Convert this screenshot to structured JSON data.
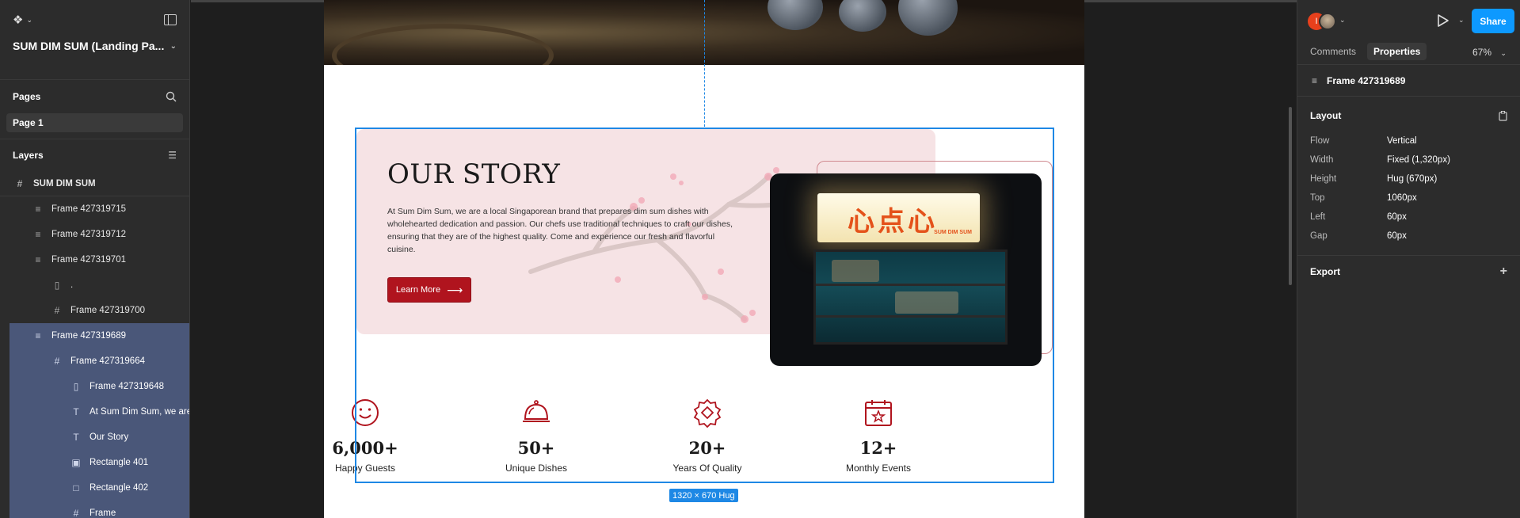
{
  "left_panel": {
    "file_title": "SUM DIM SUM (Landing Pa...",
    "pages_heading": "Pages",
    "current_page": "Page 1",
    "layers_heading": "Layers",
    "layers": [
      {
        "label": "SUM DIM SUM",
        "icon": "frame-icon"
      },
      {
        "label": "Frame 427319715",
        "icon": "auto-layout-icon"
      },
      {
        "label": "Frame 427319712",
        "icon": "auto-layout-icon"
      },
      {
        "label": "Frame 427319701",
        "icon": "auto-layout-icon"
      },
      {
        "label": ".",
        "icon": "component-instance-icon"
      },
      {
        "label": "Frame 427319700",
        "icon": "frame-icon"
      },
      {
        "label": "Frame 427319689",
        "icon": "auto-layout-icon"
      },
      {
        "label": "Frame 427319664",
        "icon": "frame-icon"
      },
      {
        "label": "Frame 427319648",
        "icon": "component-instance-icon"
      },
      {
        "label": "At Sum Dim Sum, we are",
        "icon": "text-icon"
      },
      {
        "label": "Our Story",
        "icon": "text-icon"
      },
      {
        "label": "Rectangle 401",
        "icon": "image-icon"
      },
      {
        "label": "Rectangle 402",
        "icon": "rectangle-icon"
      },
      {
        "label": "Frame",
        "icon": "frame-icon"
      }
    ]
  },
  "canvas": {
    "story_title": "OUR STORY",
    "story_body": "At Sum Dim Sum, we are a local Singaporean brand that prepares dim sum dishes with wholehearted dedication and passion. Our chefs use traditional techniques to craft our dishes, ensuring that they are of the highest quality. Come and experience our fresh and flavorful cuisine.",
    "learn_more": "Learn More",
    "sign_chinese": "心点心",
    "sign_english": "SUM DIM SUM",
    "stats": [
      {
        "value": "6,000+",
        "label": "Happy Guests",
        "icon": "smiley-face-icon"
      },
      {
        "value": "50+",
        "label": "Unique Dishes",
        "icon": "cloche-icon"
      },
      {
        "value": "20+",
        "label": "Years Of Quality",
        "icon": "award-badge-icon"
      },
      {
        "value": "12+",
        "label": "Monthly Events",
        "icon": "calendar-star-icon"
      }
    ],
    "size_badge": "1320 × 670 Hug"
  },
  "right_panel": {
    "share": "Share",
    "avatar_initial": "I",
    "tabs": {
      "comments": "Comments",
      "properties": "Properties"
    },
    "zoom": "67%",
    "selection_name": "Frame 427319689",
    "layout_heading": "Layout",
    "properties": [
      {
        "key": "Flow",
        "value": "Vertical"
      },
      {
        "key": "Width",
        "value": "Fixed (1,320px)"
      },
      {
        "key": "Height",
        "value": "Hug (670px)"
      },
      {
        "key": "Top",
        "value": "1060px"
      },
      {
        "key": "Left",
        "value": "60px"
      },
      {
        "key": "Gap",
        "value": "60px"
      }
    ],
    "export_heading": "Export"
  },
  "colors": {
    "accent": "#0d99ff",
    "brand_red": "#b0141e",
    "selection_blue": "#1e88e5",
    "story_card_bg": "#f6e3e5"
  }
}
